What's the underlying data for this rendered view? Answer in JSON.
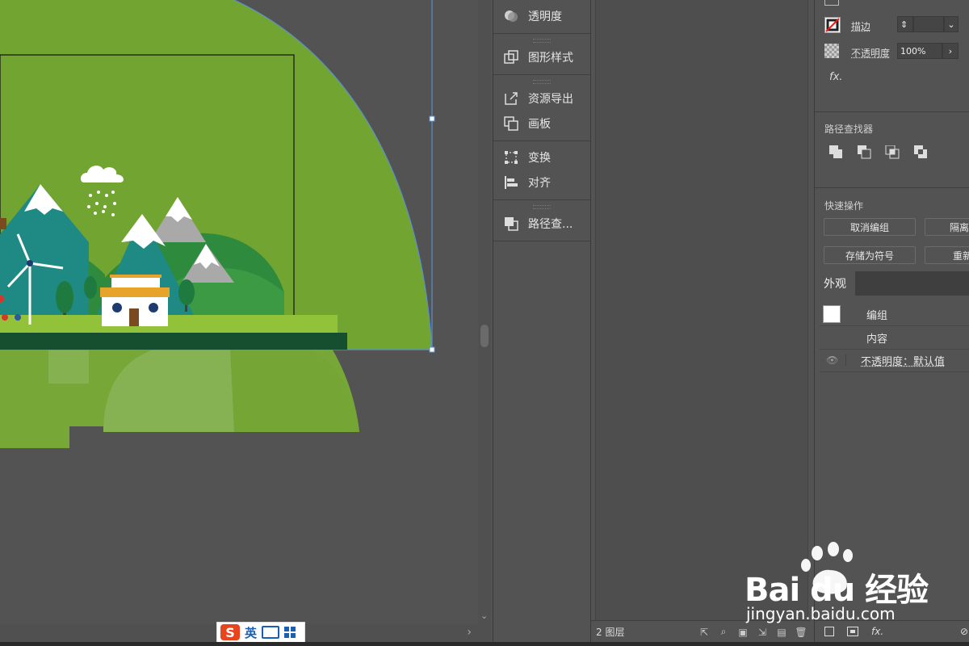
{
  "dock": {
    "items": [
      {
        "label": "透明度",
        "icon": "transparency-icon"
      },
      {
        "label": "图形样式",
        "icon": "graphic-styles-icon"
      },
      {
        "label": "资源导出",
        "icon": "asset-export-icon"
      },
      {
        "label": "画板",
        "icon": "artboards-icon"
      },
      {
        "label": "变换",
        "icon": "transform-icon"
      },
      {
        "label": "对齐",
        "icon": "align-icon"
      },
      {
        "label": "路径查...",
        "icon": "pathfinder-icon"
      }
    ]
  },
  "layers": {
    "count_label": "2 图层"
  },
  "properties": {
    "stroke_label": "描边",
    "opacity_label": "不透明度",
    "opacity_value": "100%",
    "fx_label": "fx.",
    "pathfinder_title": "路径查找器",
    "quick_actions_title": "快速操作",
    "btn_ungroup": "取消编组",
    "btn_isolate": "隔离",
    "btn_save_symbol": "存储为符号",
    "btn_recolor": "重新"
  },
  "appearance": {
    "tab_label": "外观",
    "group_label": "编组",
    "contents_label": "内容",
    "opacity_row": "不透明度：默认值"
  },
  "ime": {
    "mode": "英"
  },
  "watermark": {
    "logo_text": "Bai du 经验",
    "url": "jingyan.baidu.com"
  }
}
